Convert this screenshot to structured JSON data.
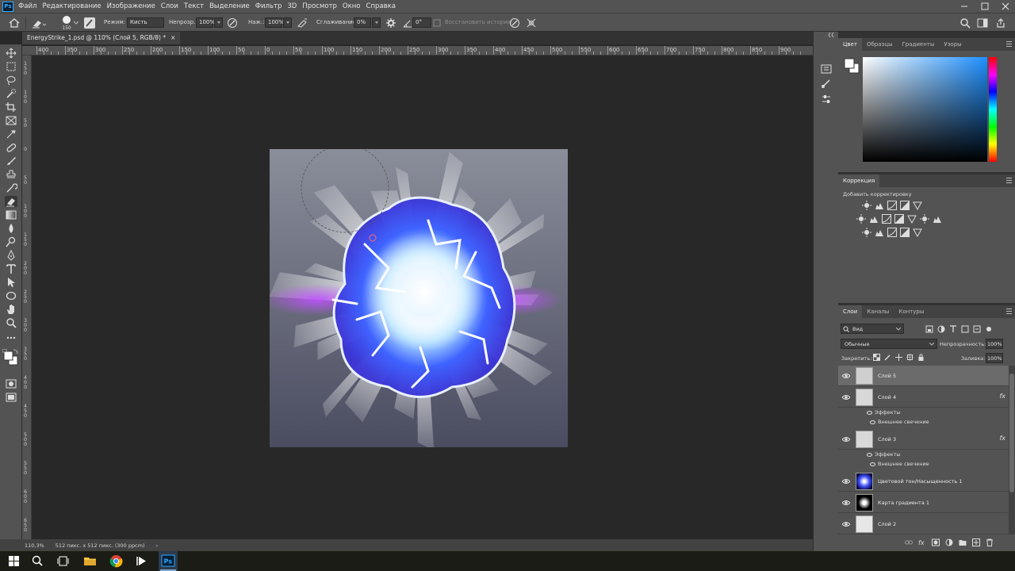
{
  "app": {
    "logo": "Ps"
  },
  "menu": [
    "Файл",
    "Редактирование",
    "Изображение",
    "Слои",
    "Текст",
    "Выделение",
    "Фильтр",
    "3D",
    "Просмотр",
    "Окно",
    "Справка"
  ],
  "options": {
    "brush_size": "150",
    "mode_label": "Режим:",
    "mode_value": "Кисть",
    "opacity_label": "Непрозр.:",
    "opacity_value": "100%",
    "pressure_label": "Наж.:",
    "pressure_value": "100%",
    "smoothing_label": "Сглаживание:",
    "smoothing_value": "0%",
    "angle_value": "0°",
    "restore_history": "Восстановить историю"
  },
  "document": {
    "tab_title": "EnergyStrike_1.psd @ 110% (Слой 5, RGB/8) *",
    "tab_close": "×"
  },
  "rulers": {
    "top": [
      "400",
      "350",
      "300",
      "250",
      "200",
      "150",
      "100",
      "50",
      "0",
      "50",
      "100",
      "150",
      "200",
      "250",
      "300",
      "350",
      "400",
      "450",
      "500",
      "550",
      "600",
      "650",
      "700",
      "750",
      "800",
      "850",
      "900"
    ],
    "left": [
      "1 5 0",
      "1 0 0",
      "5 0",
      "0",
      "5 0",
      "1 0 0",
      "1 5 0",
      "2 0 0",
      "2 5 0",
      "3 0 0",
      "3 5 0",
      "4 0 0",
      "4 5 0",
      "5 0 0",
      "5 5 0",
      "6 0 0",
      "6 5 0"
    ]
  },
  "status": {
    "zoom": "110,3%",
    "doc_info": "512 пикс. x 512 пикс. (300 ppcm)",
    "arrow": "›"
  },
  "color_panel": {
    "tabs": [
      "Цвет",
      "Образцы",
      "Градиенты",
      "Узоры"
    ],
    "active_tab": "Цвет",
    "hue_color": "#1e90ff",
    "foreground": "#ffffff",
    "background": "#ffffff"
  },
  "adjustments_panel": {
    "tabs": [
      "Коррекция"
    ],
    "add_label": "Добавить корректировку",
    "icons_row1": [
      "brightness-icon",
      "levels-icon",
      "curves-icon",
      "exposure-icon",
      "gradient-triangle-icon"
    ],
    "icons_row2": [
      "vibrance-icon",
      "hue-sat-icon",
      "color-balance-icon",
      "bw-icon",
      "photo-filter-icon",
      "channel-mixer-icon",
      "color-lookup-icon"
    ],
    "icons_row3": [
      "invert-icon",
      "posterize-icon",
      "threshold-icon",
      "selective-color-icon",
      "gradient-map-icon"
    ]
  },
  "layers_panel": {
    "tabs": [
      "Слои",
      "Каналы",
      "Контуры"
    ],
    "active_tab": "Слои",
    "filter_label": "Вид",
    "blend_mode": "Обычные",
    "opacity_label": "Непрозрачность:",
    "opacity_value": "100%",
    "lock_label": "Закрепить:",
    "fill_label": "Заливка:",
    "fill_value": "100%",
    "layers": [
      {
        "name": "Слой 5",
        "selected": true,
        "fx": false,
        "thumb": "transparent"
      },
      {
        "name": "Слой 4",
        "selected": false,
        "fx": true,
        "thumb": "transparent",
        "effects_label": "Эффекты",
        "effect": "Внешнее свечение"
      },
      {
        "name": "Слой 3",
        "selected": false,
        "fx": true,
        "thumb": "transparent",
        "effects_label": "Эффекты",
        "effect": "Внешнее свечение"
      },
      {
        "name": "Цветовой тон/Насыщенность 1",
        "selected": false,
        "fx": false,
        "thumb": "hue"
      },
      {
        "name": "Карта градиента 1",
        "selected": false,
        "fx": false,
        "thumb": "gradient"
      },
      {
        "name": "Слой 2",
        "selected": false,
        "fx": false,
        "thumb": "sketch"
      }
    ],
    "fx_symbol": "fx"
  }
}
